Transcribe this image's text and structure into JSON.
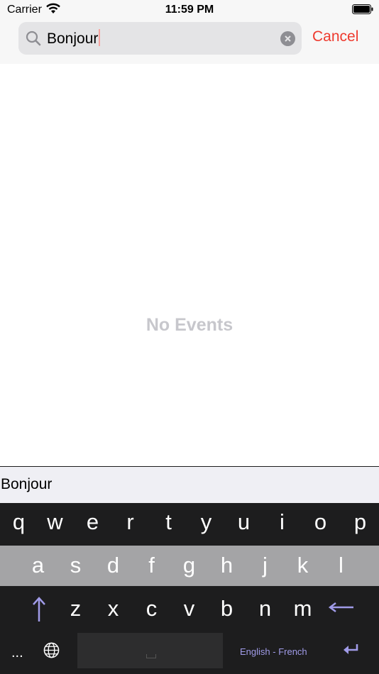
{
  "status_bar": {
    "carrier": "Carrier",
    "time": "11:59 PM"
  },
  "search": {
    "value": "Bonjour",
    "cancel_label": "Cancel",
    "icons": {
      "search": "magnifier-icon",
      "clear": "clear-circle-x-icon"
    }
  },
  "content": {
    "empty_message": "No Events"
  },
  "keyboard": {
    "suggestion": "Bonjour",
    "row1": [
      "q",
      "w",
      "e",
      "r",
      "t",
      "y",
      "u",
      "i",
      "o",
      "p"
    ],
    "row2": [
      "a",
      "s",
      "d",
      "f",
      "g",
      "h",
      "j",
      "k",
      "l"
    ],
    "row3": [
      "z",
      "x",
      "c",
      "v",
      "b",
      "n",
      "m"
    ],
    "more_label": "...",
    "language_label": "English - French",
    "icons": {
      "shift": "up-arrow-icon",
      "backspace": "left-arrow-icon",
      "globe": "globe-icon",
      "return": "return-icon"
    }
  },
  "colors": {
    "accent": "#ee3a2e",
    "keyboard_dark": "#1d1d1e",
    "keyboard_mid": "#a4a4a6",
    "language_label": "#a09be8"
  }
}
